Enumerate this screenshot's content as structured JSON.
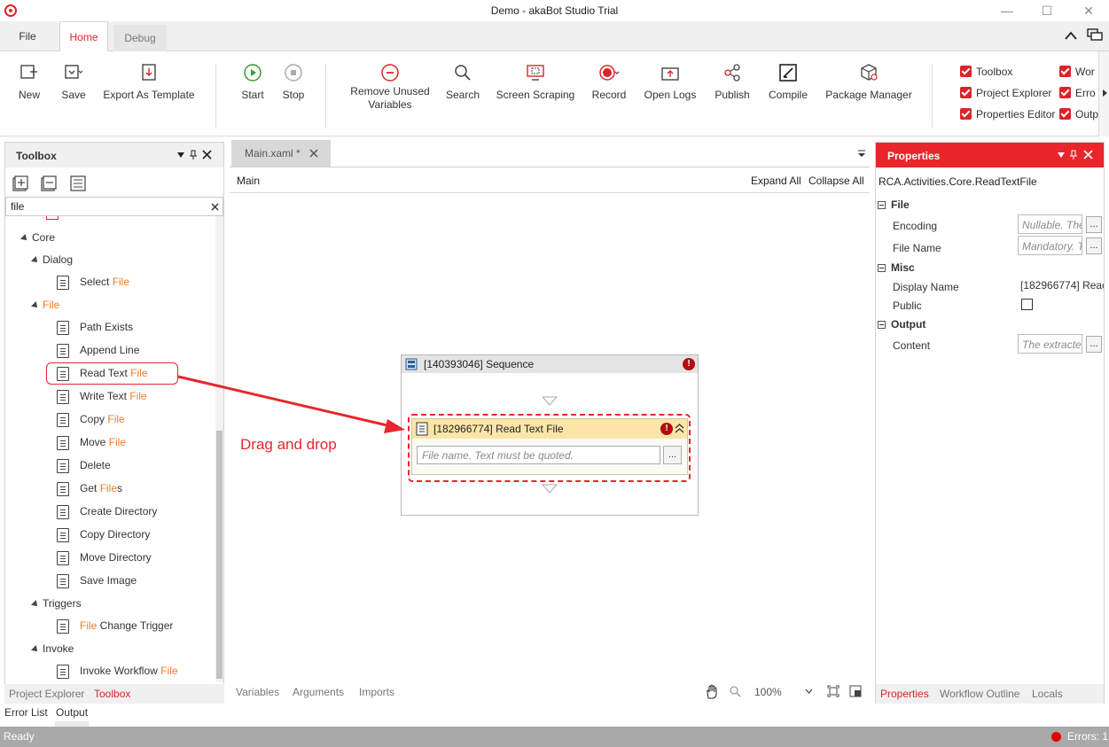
{
  "window": {
    "title": "Demo - akaBot Studio Trial",
    "minimize": "—",
    "maximize": "☐",
    "close": "✕"
  },
  "ribbon_tabs": [
    {
      "label": "File"
    },
    {
      "label": "Home"
    },
    {
      "label": "Debug"
    }
  ],
  "ribbon": {
    "new": "New",
    "save": "Save",
    "export": "Export As Template",
    "start": "Start",
    "stop": "Stop",
    "remove_unused_1": "Remove Unused",
    "remove_unused_2": "Variables",
    "search": "Search",
    "screen_scraping": "Screen Scraping",
    "record": "Record",
    "open_logs": "Open Logs",
    "publish": "Publish",
    "compile": "Compile",
    "package_manager": "Package Manager",
    "checkboxes": [
      "Toolbox",
      "Project Explorer",
      "Properties Editor",
      "Wor",
      "Erro",
      "Outp"
    ]
  },
  "toolbox": {
    "title": "Toolbox",
    "search_value": "file",
    "tree": {
      "core": "Core",
      "dialog": "Dialog",
      "select_file_a": "Select ",
      "select_file_b": "File",
      "file_group": "File",
      "path_exists": "Path Exists",
      "append_line": "Append Line",
      "read_text_a": "Read Text ",
      "read_text_b": "File",
      "write_text_a": "Write Text ",
      "write_text_b": "File",
      "copy_file_a": "Copy ",
      "copy_file_b": "File",
      "move_file_a": "Move ",
      "move_file_b": "File",
      "delete": "Delete",
      "get_files_a": "Get ",
      "get_files_b": "File",
      "get_files_c": "s",
      "create_directory": "Create Directory",
      "copy_directory": "Copy Directory",
      "move_directory": "Move Directory",
      "save_image": "Save Image",
      "triggers": "Triggers",
      "file_change_a": "File",
      "file_change_b": " Change Trigger",
      "invoke": "Invoke",
      "invoke_wf_a": "Invoke Workflow ",
      "invoke_wf_b": "File"
    },
    "bottom_tabs": [
      "Project Explorer",
      "Toolbox"
    ]
  },
  "bottom_tabs_lower": [
    "Error List",
    "Output"
  ],
  "designer": {
    "doc_tab": "Main.xaml *",
    "breadcrumb": "Main",
    "expand_all": "Expand All",
    "collapse_all": "Collapse All",
    "sequence_title": "[140393046] Sequence",
    "activity_title": "[182966774] Read Text File",
    "file_placeholder": "File name. Text must be quoted.",
    "ellipsis": "...",
    "annotation": "Drag and drop",
    "bottom_tabs": [
      "Variables",
      "Arguments",
      "Imports"
    ],
    "zoom": "100%",
    "annotation_color": "#e8262c"
  },
  "properties": {
    "title": "Properties",
    "type_name": "RCA.Activities.Core.ReadTextFile",
    "cat_file": "File",
    "encoding_label": "Encoding",
    "encoding_ph": "Nullable. The",
    "file_name_label": "File Name",
    "file_name_ph": "Mandatory. T",
    "cat_misc": "Misc",
    "display_name_label": "Display Name",
    "display_name_value": "[182966774] Reac",
    "public_label": "Public",
    "cat_output": "Output",
    "content_label": "Content",
    "content_ph": "The extracte",
    "bottom_tabs": [
      "Properties",
      "Workflow Outline",
      "Locals"
    ]
  },
  "status": {
    "ready": "Ready",
    "errors": "Errors: 1"
  },
  "colors": {
    "accent": "#e8262c",
    "highlight": "#ef7a2a",
    "status_bar": "#a9a9a9"
  }
}
